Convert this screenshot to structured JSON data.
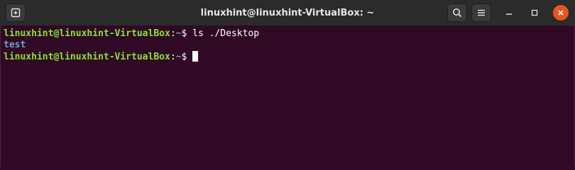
{
  "window": {
    "title": "linuxhint@linuxhint-VirtualBox: ~"
  },
  "titlebar": {
    "new_tab_icon": "new-tab-icon",
    "search_icon": "search-icon",
    "menu_icon": "hamburger-menu-icon",
    "minimize_icon": "minimize-icon",
    "maximize_icon": "maximize-icon",
    "close_icon": "close-icon"
  },
  "colors": {
    "background": "#300a24",
    "prompt_user": "#8ae234",
    "prompt_path": "#729fcf",
    "close_button": "#e95420"
  },
  "terminal": {
    "lines": [
      {
        "user_host": "linuxhint@linuxhint-VirtualBox",
        "colon": ":",
        "path": "~",
        "dollar": "$ ",
        "command": "ls ./Desktop"
      },
      {
        "output": "test"
      },
      {
        "user_host": "linuxhint@linuxhint-VirtualBox",
        "colon": ":",
        "path": "~",
        "dollar": "$ ",
        "command": ""
      }
    ]
  }
}
